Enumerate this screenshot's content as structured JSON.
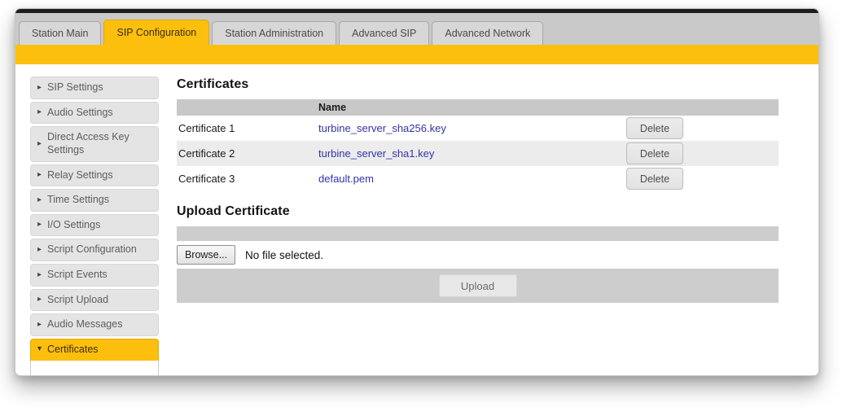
{
  "tabs": {
    "items": [
      {
        "label": "Station Main",
        "active": false
      },
      {
        "label": "SIP Configuration",
        "active": true
      },
      {
        "label": "Station Administration",
        "active": false
      },
      {
        "label": "Advanced SIP",
        "active": false
      },
      {
        "label": "Advanced Network",
        "active": false
      }
    ]
  },
  "sidebar": {
    "items": [
      {
        "label": "SIP Settings",
        "active": false
      },
      {
        "label": "Audio Settings",
        "active": false
      },
      {
        "label": "Direct Access Key Settings",
        "active": false
      },
      {
        "label": "Relay Settings",
        "active": false
      },
      {
        "label": "Time Settings",
        "active": false
      },
      {
        "label": "I/O Settings",
        "active": false
      },
      {
        "label": "Script Configuration",
        "active": false
      },
      {
        "label": "Script Events",
        "active": false
      },
      {
        "label": "Script Upload",
        "active": false
      },
      {
        "label": "Audio Messages",
        "active": false
      },
      {
        "label": "Certificates",
        "active": true
      }
    ],
    "collapsed_icon": "▸",
    "expanded_icon": "▾"
  },
  "certificates": {
    "title": "Certificates",
    "table": {
      "name_header": "Name",
      "rows": [
        {
          "label": "Certificate 1",
          "file": "turbine_server_sha256.key",
          "action": "Delete"
        },
        {
          "label": "Certificate 2",
          "file": "turbine_server_sha1.key",
          "action": "Delete"
        },
        {
          "label": "Certificate 3",
          "file": "default.pem",
          "action": "Delete"
        }
      ]
    }
  },
  "upload": {
    "title": "Upload Certificate",
    "browse_label": "Browse...",
    "file_status": "No file selected.",
    "upload_label": "Upload"
  },
  "colors": {
    "accent_yellow": "#fcbf0e",
    "tab_strip_gray": "#c9c9c9",
    "table_header_gray": "#c8c8c8",
    "alt_row_gray": "#ececec",
    "link_blue": "#3333aa",
    "top_bar_black": "#1d1d1d"
  }
}
